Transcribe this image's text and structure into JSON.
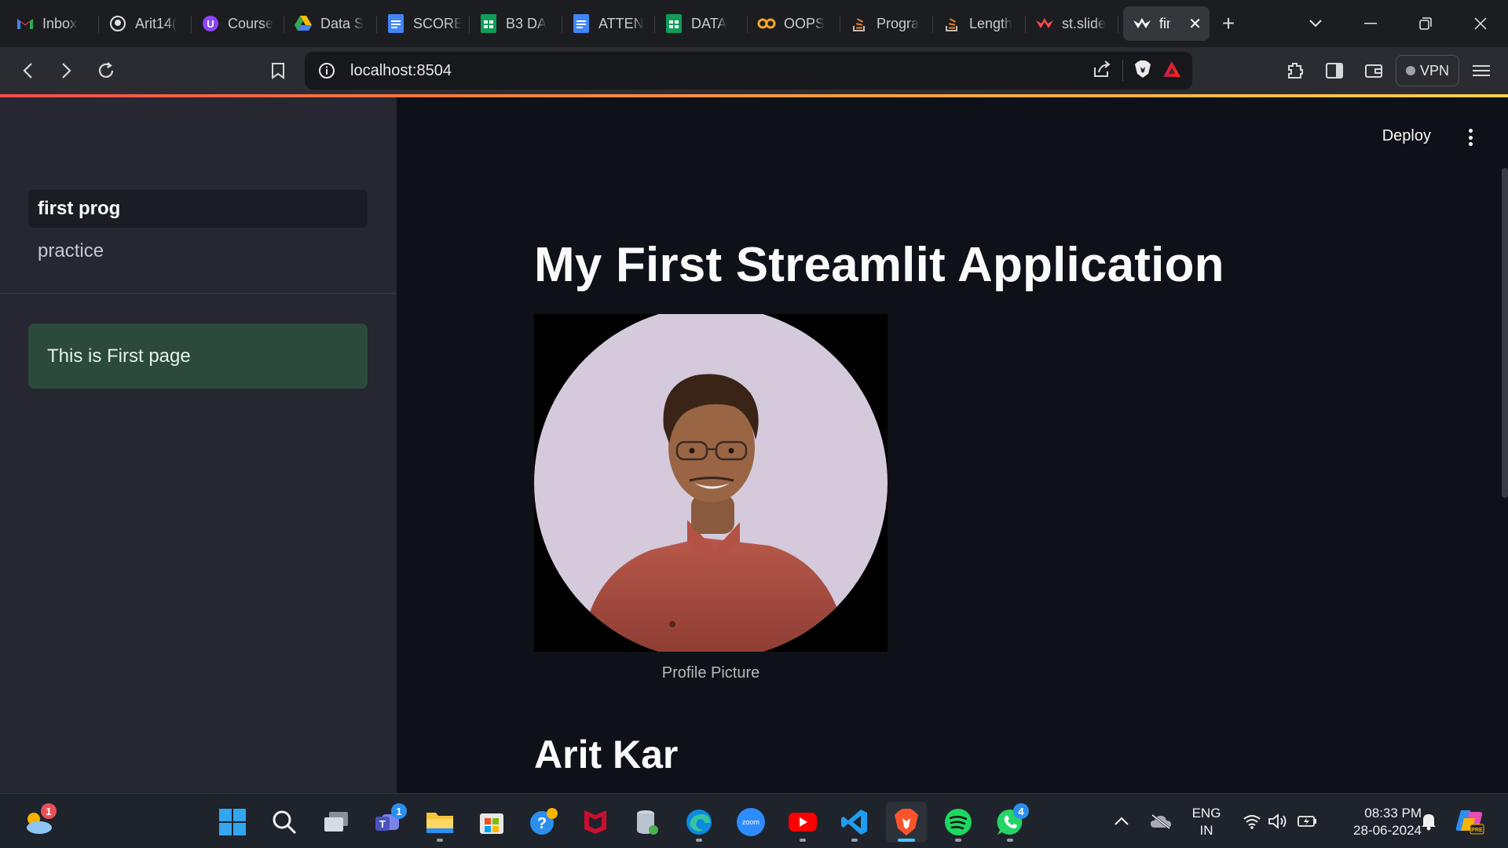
{
  "browser": {
    "tabs": [
      {
        "title": "Inbox",
        "icon": "gmail-icon"
      },
      {
        "title": "Arit14(",
        "icon": "github-icon"
      },
      {
        "title": "Course",
        "icon": "course-icon"
      },
      {
        "title": "Data S",
        "icon": "google-drive-icon"
      },
      {
        "title": "SCORE",
        "icon": "google-docs-icon"
      },
      {
        "title": "B3 DA",
        "icon": "google-sheets-icon"
      },
      {
        "title": "ATTEN",
        "icon": "google-docs-icon"
      },
      {
        "title": "DATA",
        "icon": "google-sheets-icon"
      },
      {
        "title": "OOPS",
        "icon": "codingninjas-icon"
      },
      {
        "title": "Progra",
        "icon": "stackoverflow-icon"
      },
      {
        "title": "Length",
        "icon": "stackoverflow-icon"
      },
      {
        "title": "st.slide",
        "icon": "streamlit-icon"
      }
    ],
    "active_tab": {
      "title": "fir",
      "icon": "streamlit-icon"
    },
    "url": "localhost:8504",
    "vpn_label": "VPN"
  },
  "streamlit": {
    "deploy_label": "Deploy",
    "sidebar": {
      "pages": [
        {
          "label": "first prog",
          "active": true
        },
        {
          "label": "practice",
          "active": false
        }
      ],
      "alert": "This is First page"
    },
    "main": {
      "title": "My First Streamlit Application",
      "image_caption": "Profile Picture",
      "heading": "Arit Kar"
    }
  },
  "taskbar": {
    "weather_badge": "1",
    "teams_badge": "1",
    "whatsapp_badge": "4",
    "language_top": "ENG",
    "language_bottom": "IN",
    "time": "08:33 PM",
    "date": "28-06-2024"
  },
  "colors": {
    "accent_red": "#ff4b4b",
    "sidebar_bg": "#262730",
    "main_bg": "#0e1117",
    "success_bg": "#2c4a3b"
  }
}
